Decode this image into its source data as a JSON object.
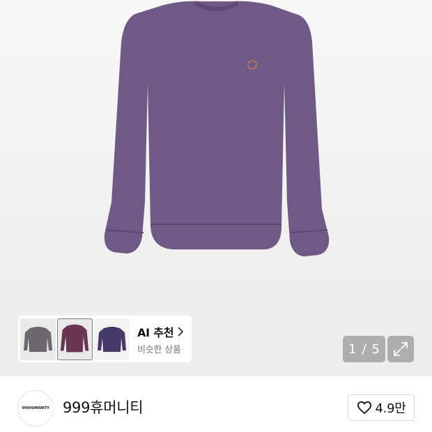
{
  "product_image": {
    "color": "#6f5a86",
    "logo_icon": "circle-logo-icon"
  },
  "ai_recommend": {
    "title": "AI 추천",
    "subtitle": "비슷한 상품",
    "chevron_icon": "chevron-right-icon",
    "thumbnails": [
      {
        "name": "thumb-gray-longsleeve",
        "color": "#6e6770"
      },
      {
        "name": "thumb-burgundy-longsleeve",
        "color": "#6a3550",
        "selected": true
      },
      {
        "name": "thumb-purple-longsleeve",
        "color": "#463a68"
      }
    ]
  },
  "pager": {
    "current": "1",
    "separator": "/",
    "total": "5"
  },
  "expand_icon": "expand-arrows-icon",
  "brand": {
    "logo_text": "999HUMANITY",
    "name": "999휴머니티"
  },
  "like": {
    "icon": "heart-outline-icon",
    "count": "4.9만"
  }
}
